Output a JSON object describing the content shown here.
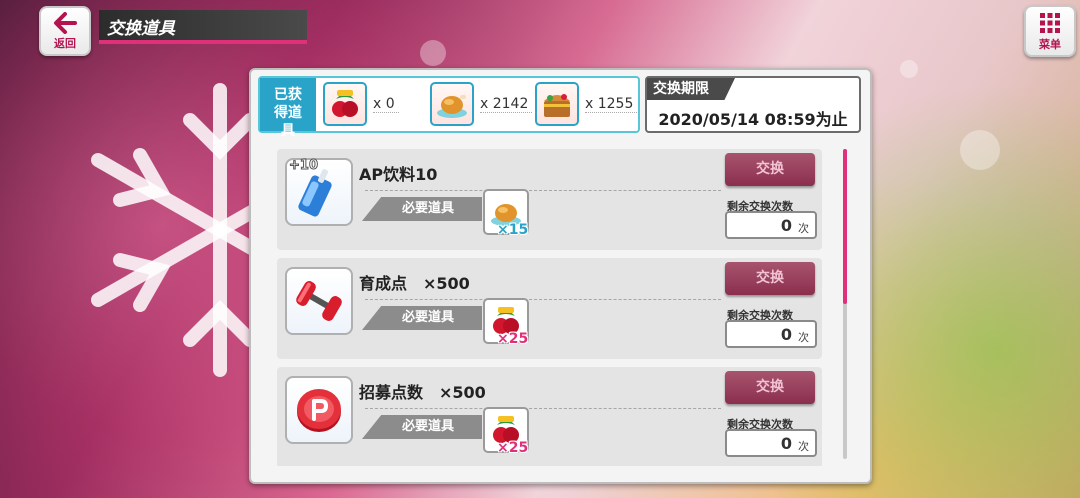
{
  "header": {
    "back_label": "返回",
    "title": "交换道具",
    "menu_label": "菜单"
  },
  "owned": {
    "label": "已获得道具",
    "items": [
      {
        "icon": "christmas-gift-item-icon",
        "count": "x 0"
      },
      {
        "icon": "roast-chicken-item-icon",
        "count": "x 2142"
      },
      {
        "icon": "treasure-chest-item-icon",
        "count": "x 1255"
      }
    ]
  },
  "deadline": {
    "label": "交换期限",
    "value": "2020/05/14 08:59为止"
  },
  "rows": [
    {
      "icon": "ap-drink-icon",
      "badge": "+10",
      "name": "AP饮料10",
      "required_label": "必要道具",
      "required_icon": "roast-chicken-item-icon",
      "required_qty": "×15",
      "qty_color": "#2aa3c9",
      "exchange_label": "交换",
      "remaining_label": "剩余交换次数",
      "remaining_value": "0",
      "remaining_unit": "次"
    },
    {
      "icon": "dumbbell-icon",
      "name": "育成点　×500",
      "required_label": "必要道具",
      "required_icon": "christmas-gift-item-icon",
      "required_qty": "×25",
      "qty_color": "#e0307a",
      "exchange_label": "交换",
      "remaining_label": "剩余交换次数",
      "remaining_value": "0",
      "remaining_unit": "次"
    },
    {
      "icon": "recruit-coin-icon",
      "name": "招募点数　×500",
      "required_label": "必要道具",
      "required_icon": "christmas-gift-item-icon",
      "required_qty": "×25",
      "qty_color": "#e0307a",
      "exchange_label": "交换",
      "remaining_label": "剩余交换次数",
      "remaining_value": "0",
      "remaining_unit": "次"
    }
  ],
  "colors": {
    "accent": "#e0307a",
    "owned_label_bg": "#2aa3c9",
    "exchange_button": "#8a2f4d"
  }
}
